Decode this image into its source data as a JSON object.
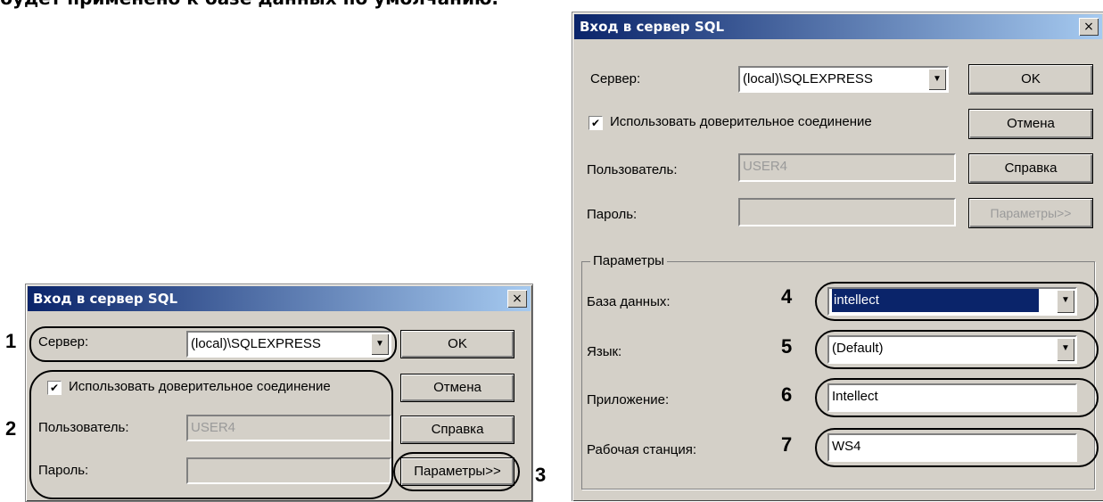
{
  "caption": "будет применено к базе данных по умолчанию.",
  "small_dialog": {
    "title": "Вход в сервер SQL",
    "close": "×",
    "server_label": "Сервер:",
    "server_value": "(local)\\SQLEXPRESS",
    "trusted_label": "Использовать доверительное соединение",
    "user_label": "Пользователь:",
    "user_value": "USER4",
    "password_label": "Пароль:",
    "ok": "OK",
    "cancel": "Отмена",
    "help": "Справка",
    "params": "Параметры>>"
  },
  "large_dialog": {
    "title": "Вход в сервер SQL",
    "close": "×",
    "server_label": "Сервер:",
    "server_value": "(local)\\SQLEXPRESS",
    "trusted_label": "Использовать доверительное соединение",
    "user_label": "Пользователь:",
    "user_value": "USER4",
    "password_label": "Пароль:",
    "ok": "OK",
    "cancel": "Отмена",
    "help": "Справка",
    "params": "Параметры>>",
    "group_title": "Параметры",
    "db_label": "База данных:",
    "db_value": "intellect",
    "lang_label": "Язык:",
    "lang_value": "(Default)",
    "app_label": "Приложение:",
    "app_value": "Intellect",
    "ws_label": "Рабочая станция:",
    "ws_value": "WS4"
  },
  "callouts": [
    "1",
    "2",
    "3",
    "4",
    "5",
    "6",
    "7"
  ],
  "checkmark": "✔",
  "dropdown_arrow": "▼"
}
